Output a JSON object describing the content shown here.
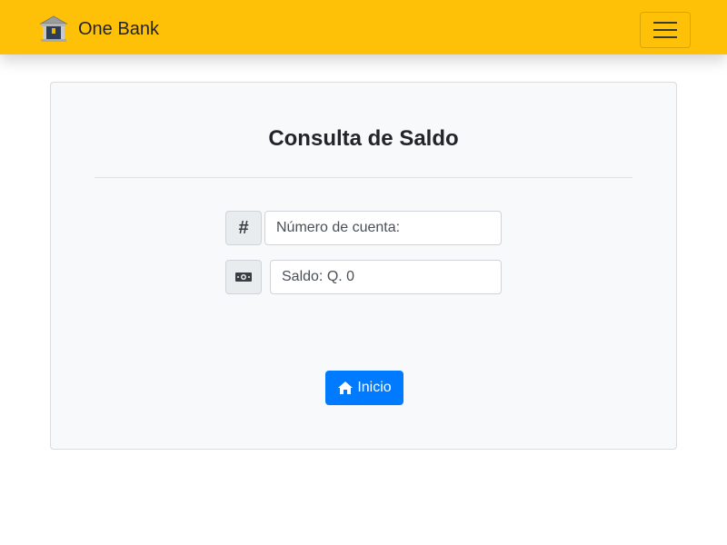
{
  "navbar": {
    "brand_name": "One Bank",
    "brand_icon": "bank-icon",
    "menu_icon": "hamburger-menu-icon",
    "background_color": "#ffc107"
  },
  "card": {
    "title": "Consulta de Saldo",
    "account_field": {
      "addon_symbol": "#",
      "placeholder": "Número de cuenta:"
    },
    "balance_field": {
      "addon_icon": "money-bill-icon",
      "placeholder": "Saldo: Q. 0"
    },
    "home_button": {
      "label": "Inicio",
      "icon": "home-icon",
      "color": "#007bff"
    }
  }
}
